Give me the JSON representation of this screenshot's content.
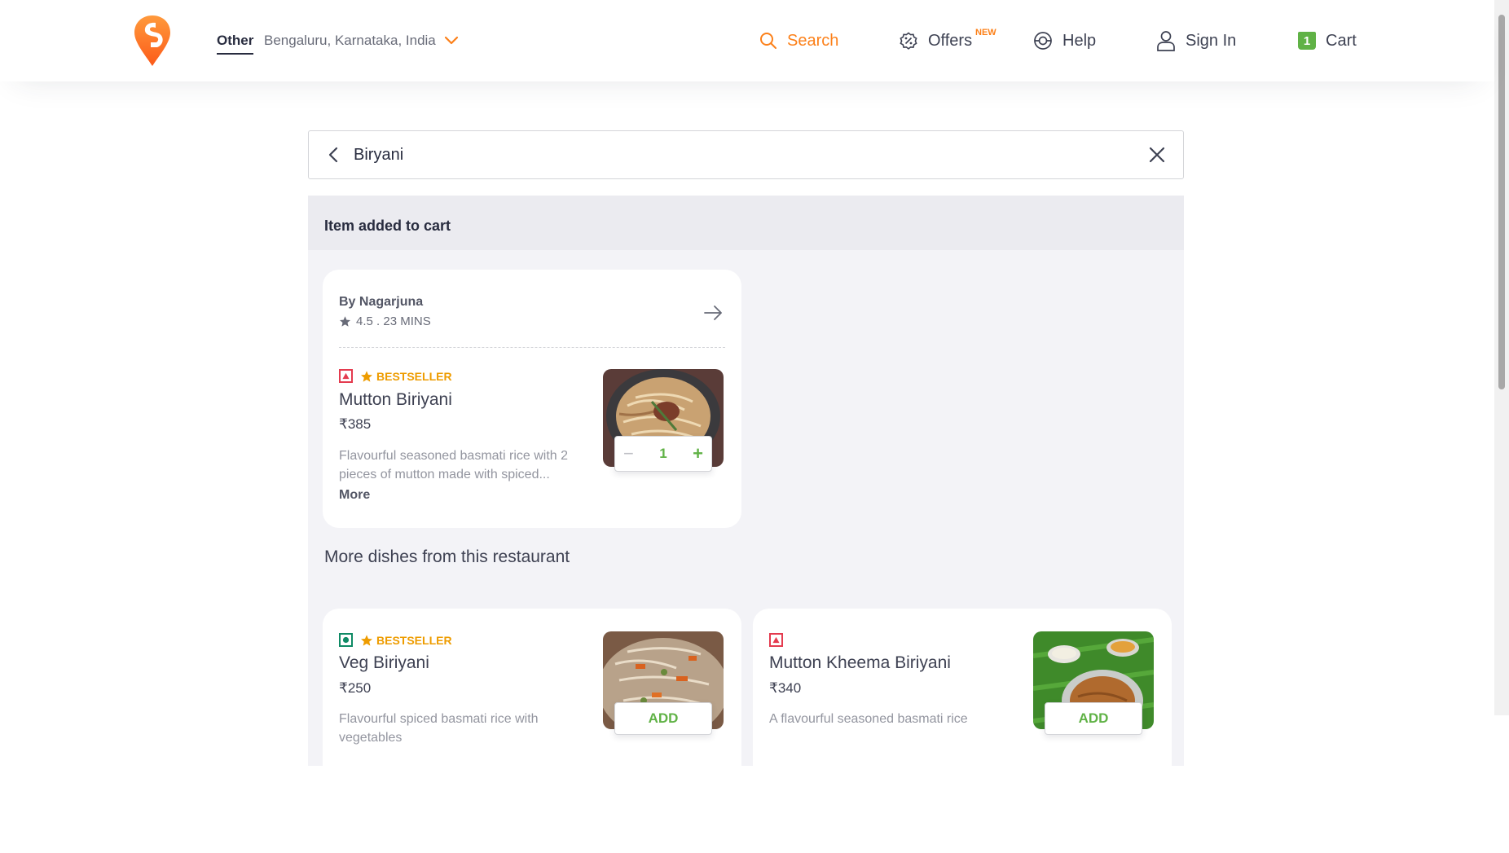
{
  "header": {
    "location_type": "Other",
    "location_text": "Bengaluru, Karnataka, India",
    "nav": {
      "search": "Search",
      "offers": "Offers",
      "offers_badge": "NEW",
      "help": "Help",
      "sign_in": "Sign In",
      "cart": "Cart",
      "cart_count": "1"
    },
    "brand_color": "#fc8019"
  },
  "search": {
    "value": "Biryani"
  },
  "panel": {
    "added_message": "Item added to cart",
    "restaurant": {
      "name": "By Nagarjuna",
      "meta": "4.5 . 23 MINS"
    },
    "added_item": {
      "tag": "BESTSELLER",
      "veg": false,
      "name": "Mutton Biriyani",
      "price": "₹385",
      "description_line1": "Flavourful seasoned basmati rice with 2",
      "description_line2": "pieces of mutton made with spiced...",
      "more_label": "More",
      "quantity": "1",
      "minus": "−",
      "plus": "+"
    },
    "more_dishes_title": "More dishes from this restaurant",
    "dishes": [
      {
        "veg": true,
        "tag": "BESTSELLER",
        "name": "Veg Biriyani",
        "price": "₹250",
        "description": "Flavourful spiced basmati rice with vegetables",
        "add_label": "ADD"
      },
      {
        "veg": false,
        "tag": "",
        "name": "Mutton Kheema Biriyani",
        "price": "₹340",
        "description": "A flavourful seasoned basmati rice",
        "add_label": "ADD"
      }
    ]
  },
  "colors": {
    "veg_green": "#0f8a65",
    "nonveg_red": "#e43b4f",
    "add_green": "#60b246",
    "bestseller": "#ee9c00"
  }
}
